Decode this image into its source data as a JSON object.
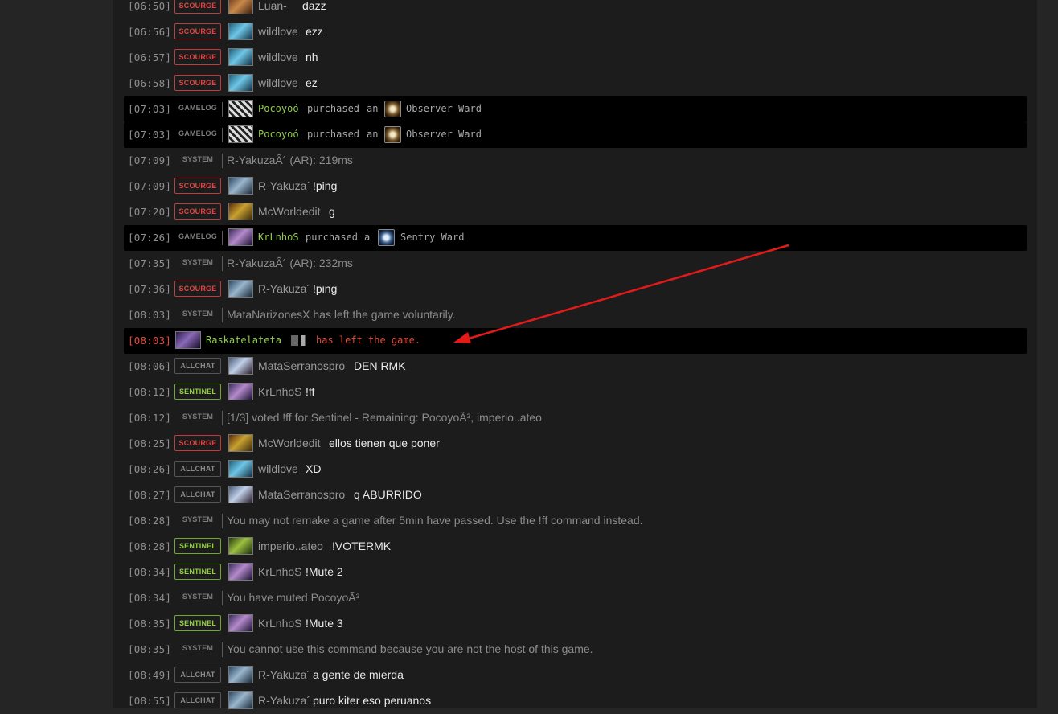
{
  "colors": {
    "scourge": "#e04545",
    "sentinel": "#93d040",
    "gamelog_name": "#8fcc4a",
    "leave": "#e24a3c"
  },
  "rows": [
    {
      "ts": "[06:50]",
      "badge": "SCOURGE",
      "name": "Luan-",
      "msg": "dazz"
    },
    {
      "ts": "[06:56]",
      "badge": "SCOURGE",
      "name": "wildlove",
      "msg": "ezz"
    },
    {
      "ts": "[06:57]",
      "badge": "SCOURGE",
      "name": "wildlove",
      "msg": "nh"
    },
    {
      "ts": "[06:58]",
      "badge": "SCOURGE",
      "name": "wildlove",
      "msg": "ez"
    },
    {
      "ts": "[07:03]",
      "badge": "GAMELOG",
      "name": "Pocoyoó",
      "verb": "purchased",
      "article": "an",
      "item": "Observer Ward"
    },
    {
      "ts": "[07:03]",
      "badge": "GAMELOG",
      "name": "Pocoyoó",
      "verb": "purchased",
      "article": "an",
      "item": "Observer Ward"
    },
    {
      "ts": "[07:09]",
      "badge": "SYSTEM",
      "text": "R-YakuzaÂ´ (AR): 219ms"
    },
    {
      "ts": "[07:09]",
      "badge": "SCOURGE",
      "name": "R-Yakuza´",
      "msg": "!ping"
    },
    {
      "ts": "[07:20]",
      "badge": "SCOURGE",
      "name": "McWorldedit",
      "msg": "g"
    },
    {
      "ts": "[07:26]",
      "badge": "GAMELOG",
      "name": "KrLnhoS",
      "verb": "purchased",
      "article": "a",
      "item": "Sentry Ward"
    },
    {
      "ts": "[07:35]",
      "badge": "SYSTEM",
      "text": "R-YakuzaÂ´ (AR): 232ms"
    },
    {
      "ts": "[07:36]",
      "badge": "SCOURGE",
      "name": "R-Yakuza´",
      "msg": "!ping"
    },
    {
      "ts": "[08:03]",
      "badge": "SYSTEM",
      "text": "MataNarizonesX has left the game voluntarily."
    },
    {
      "ts": "[08:03]",
      "name": "Raskatelateta",
      "leave": "has left the game."
    },
    {
      "ts": "[08:06]",
      "badge": "ALLCHAT",
      "name": "MataSerranospro",
      "msg": "DEN RMK"
    },
    {
      "ts": "[08:12]",
      "badge": "SENTINEL",
      "name": "KrLnhoS",
      "msg": "!ff"
    },
    {
      "ts": "[08:12]",
      "badge": "SYSTEM",
      "text": "[1/3] voted !ff for Sentinel - Remaining: PocoyoÃ³, imperio..ateo"
    },
    {
      "ts": "[08:25]",
      "badge": "SCOURGE",
      "name": "McWorldedit",
      "msg": "ellos tienen que poner"
    },
    {
      "ts": "[08:26]",
      "badge": "ALLCHAT",
      "name": "wildlove",
      "msg": "XD"
    },
    {
      "ts": "[08:27]",
      "badge": "ALLCHAT",
      "name": "MataSerranospro",
      "msg": "q ABURRIDO"
    },
    {
      "ts": "[08:28]",
      "badge": "SYSTEM",
      "text": "You may not remake a game after 5min have passed. Use the !ff command instead."
    },
    {
      "ts": "[08:28]",
      "badge": "SENTINEL",
      "name": "imperio..ateo",
      "msg": "!VOTERMK"
    },
    {
      "ts": "[08:34]",
      "badge": "SENTINEL",
      "name": "KrLnhoS",
      "msg": "!Mute 2"
    },
    {
      "ts": "[08:34]",
      "badge": "SYSTEM",
      "text": "You have muted PocoyoÃ³"
    },
    {
      "ts": "[08:35]",
      "badge": "SENTINEL",
      "name": "KrLnhoS",
      "msg": "!Mute 3"
    },
    {
      "ts": "[08:35]",
      "badge": "SYSTEM",
      "text": "You cannot use this command because you are not the host of this game."
    },
    {
      "ts": "[08:49]",
      "badge": "ALLCHAT",
      "name": "R-Yakuza´",
      "msg": "a gente de mierda"
    },
    {
      "ts": "[08:55]",
      "badge": "ALLCHAT",
      "name": "R-Yakuza´",
      "msg": "puro kiter eso peruanos"
    }
  ]
}
